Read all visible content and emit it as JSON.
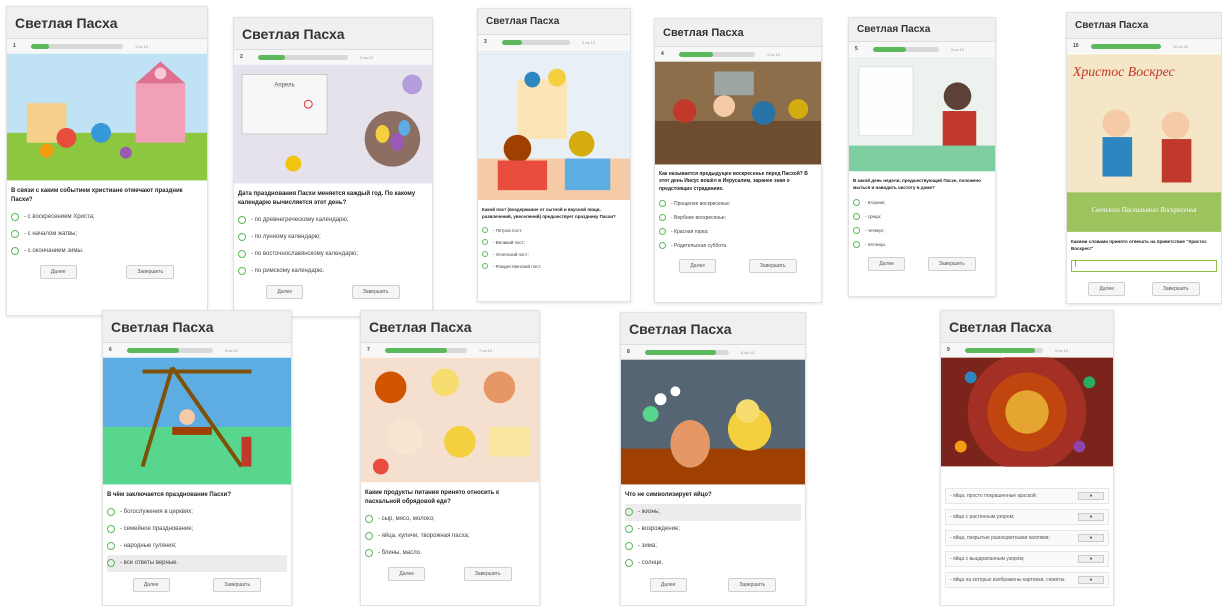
{
  "app_title": "Светлая Пасха",
  "buttons": {
    "next": "Далее",
    "finish": "Завершить"
  },
  "accent": "#5cb85c",
  "cards": [
    {
      "num": "1",
      "progress": "1 из 10",
      "fraction": 0.1,
      "question": "В связи с каким событием христиане отмечают праздник Пасхи?",
      "options": [
        "- с воскресением Христа;",
        "- с началом жатвы;",
        "- с окончанием зимы."
      ]
    },
    {
      "num": "2",
      "progress": "2 из 10",
      "fraction": 0.2,
      "question": "Дата празднования Пасхи меняется каждый год. По какому календарю вычисляется этот день?",
      "options": [
        "- по древнегреческому календарю;",
        "- по лунному календарю;",
        "- по восточнославянскому календарю;",
        "- по римскому календарю."
      ],
      "calendar_month": "Апрель"
    },
    {
      "num": "3",
      "progress": "3 из 10",
      "fraction": 0.3,
      "question": "Какой пост (воздержание от сытной и вкусной пищи, развлечений, увеселений) предшествует празднику Пасхи?",
      "options": [
        "- Петров пост;",
        "- Великий пост;",
        "- Успенский пост;",
        "- Рождественский пост."
      ]
    },
    {
      "num": "4",
      "progress": "4 из 10",
      "fraction": 0.4,
      "question": "Как называется предыдущее воскресенье перед Пасхой? В этот день Иисус вошёл в Иерусалим, заранее зная о предстоящих страданиях.",
      "options": [
        "- Прощеное воскресенье;",
        "- Вербное воскресенье;",
        "- Красная горка;",
        "- Родительская суббота."
      ]
    },
    {
      "num": "5",
      "progress": "5 из 10",
      "fraction": 0.5,
      "question": "В какой день недели, предшествующий Пасхе, положено мыться и наводить чистоту в доме?",
      "options": [
        "- вторник;",
        "- среда;",
        "- четверг;",
        "- пятница."
      ]
    },
    {
      "num": "10",
      "progress": "10 из 10",
      "fraction": 1.0,
      "question": "Какими словами принято отвечать на приветствие \"Христос Воскрес!\"",
      "banner_title": "Христос Воскрес",
      "banner_sub": "Светлого Пасхального Воскресенья"
    },
    {
      "num": "6",
      "progress": "6 из 10",
      "fraction": 0.6,
      "question": "В чём заключается празднование Пасхи?",
      "options": [
        "- богослужения в церквях;",
        "- семейное празднование;",
        "- народные гуляния;",
        "- все ответы верные."
      ]
    },
    {
      "num": "7",
      "progress": "7 из 10",
      "fraction": 0.7,
      "question": "Какие продукты питания принято относить к пасхальной обрядовой еде?",
      "options": [
        "- сыр, мясо, молоко;",
        "- яйца, куличи, творожная пасха;",
        "- блины, масло."
      ]
    },
    {
      "num": "8",
      "progress": "8 из 10",
      "fraction": 0.8,
      "question": "Что не символизирует яйцо?",
      "options": [
        "- жизнь;",
        "- возрождение;",
        "- зима;",
        "- солнце."
      ]
    },
    {
      "num": "9",
      "progress": "9 из 10",
      "fraction": 0.9,
      "matches": [
        "- яйца, просто покрашенные краской;",
        "- яйца с растенным узором;",
        "- яйца, покрытые разноцветными каплями;",
        "- яйца с выцарапанным узором;",
        "- яйца на которых изображены картинки, сюжеты."
      ]
    }
  ]
}
